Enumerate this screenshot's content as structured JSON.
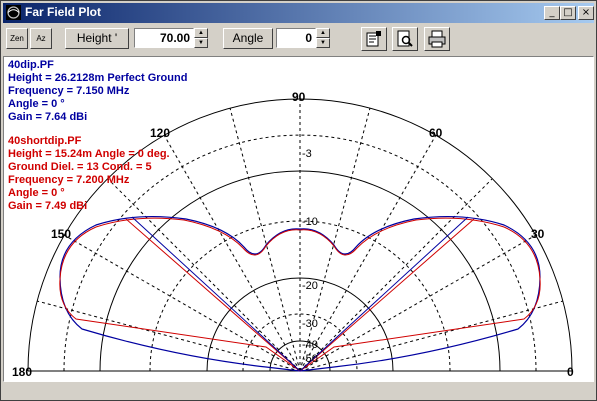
{
  "window": {
    "title": "Far Field Plot",
    "controls": {
      "minimize": "_",
      "maximize": "□",
      "close": "×"
    }
  },
  "toolbar": {
    "zen_label": "Zen",
    "az_label": "Az",
    "height_button_label": "Height '",
    "height_value": "70.00",
    "angle_button_label": "Angle",
    "angle_value": "0",
    "icons": [
      "properties-icon",
      "print-preview-icon",
      "printer-icon"
    ]
  },
  "plot": {
    "file1": {
      "name": "40dip.PF",
      "height_line": "Height =  26.2128m Perfect Ground",
      "frequency_line": "Frequency = 7.150 MHz",
      "angle_line": "Angle = 0 °",
      "gain_line": "Gain = 7.64 dBi",
      "color": "#0000a0"
    },
    "file2": {
      "name": "40shortdip.PF",
      "height_line": "Height =  15.24m Angle =  0 deg.",
      "ground_line": "Ground Diel. =  13  Cond. =  5",
      "frequency_line": "Frequency = 7.200 MHz",
      "angle_line": "Angle = 0 °",
      "gain_line": "Gain = 7.49 dBi",
      "color": "#d00000"
    },
    "angle_labels": {
      "a0": "0",
      "a30": "30",
      "a60": "60",
      "a90": "90",
      "a120": "120",
      "a150": "150",
      "a180": "180"
    },
    "ring_labels": {
      "r3": "-3",
      "r10": "-10",
      "r20": "-20",
      "r30": "-30",
      "r40": "-40",
      "r50": "-50"
    }
  }
}
